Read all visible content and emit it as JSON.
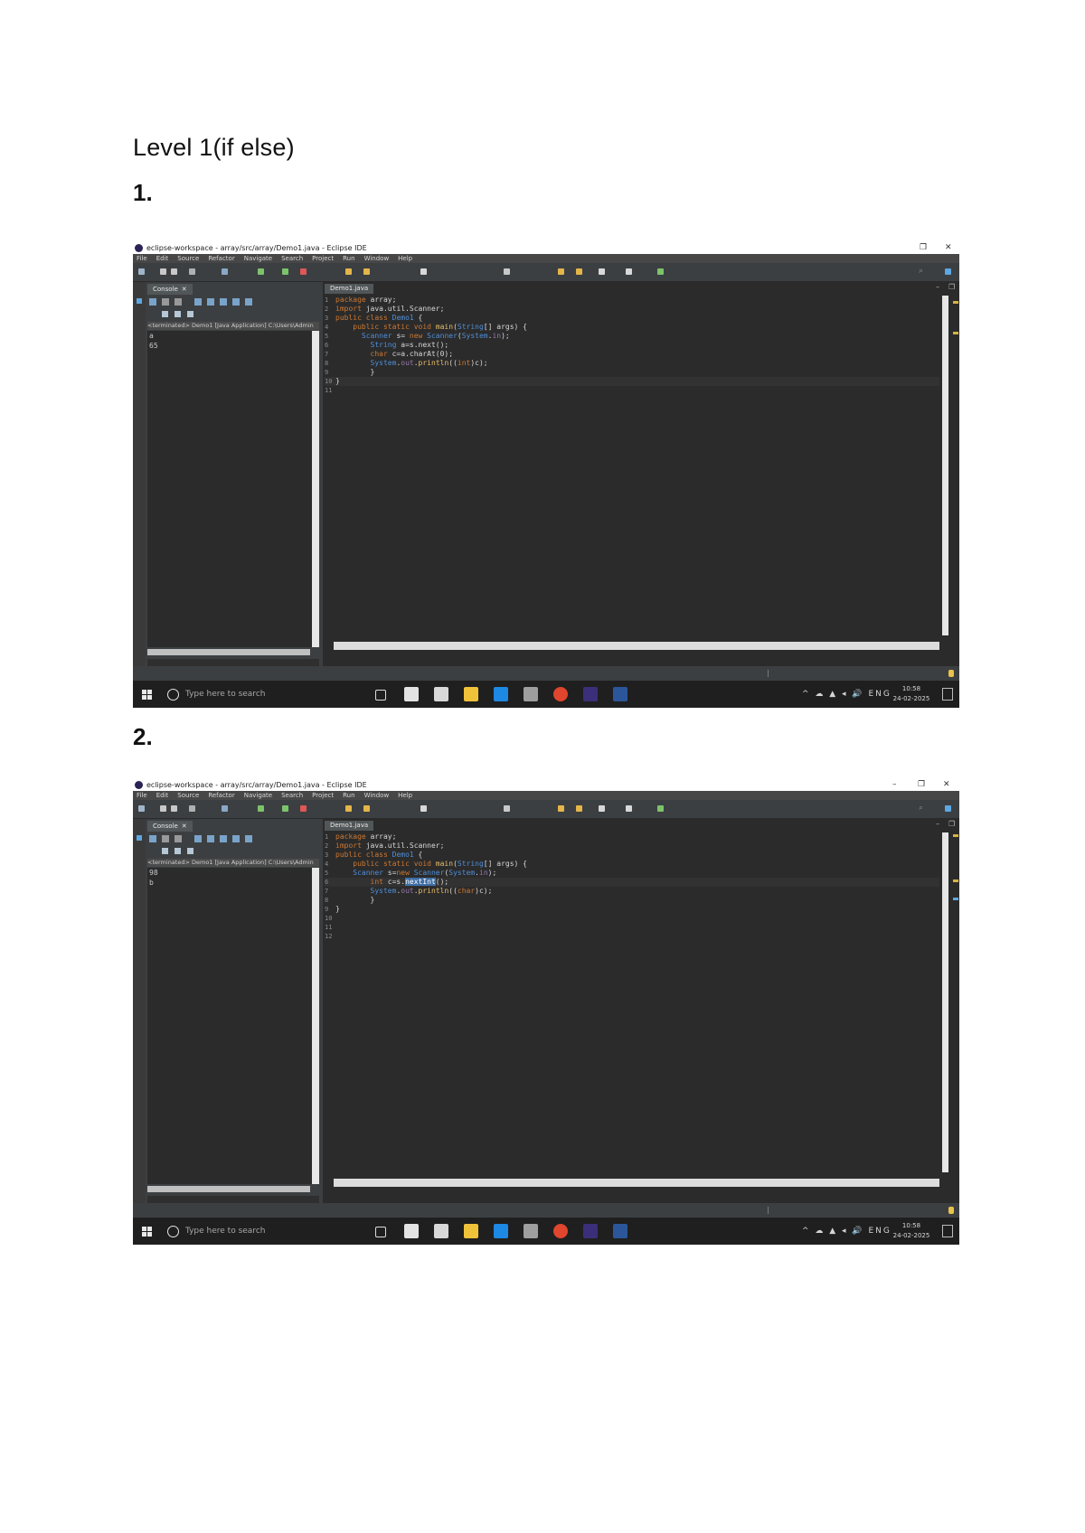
{
  "heading": "Level 1(if else)",
  "items": [
    {
      "number": "1.",
      "window_title": "eclipse-workspace - array/src/array/Demo1.java - Eclipse IDE",
      "menu": [
        "File",
        "Edit",
        "Source",
        "Refactor",
        "Navigate",
        "Search",
        "Project",
        "Run",
        "Window",
        "Help"
      ],
      "console_tab": "Console",
      "console_path": "<terminated> Demo1 [Java Application] C:\\Users\\Admin",
      "console_output": [
        "a",
        "65"
      ],
      "editor_tab": "Demo1.java",
      "taskbar_search": "Type here to search",
      "clock_time": "10:58",
      "clock_date": "24-02-2025"
    },
    {
      "number": "2.",
      "window_title": "eclipse-workspace - array/src/array/Demo1.java - Eclipse IDE",
      "menu": [
        "File",
        "Edit",
        "Source",
        "Refactor",
        "Navigate",
        "Search",
        "Project",
        "Run",
        "Window",
        "Help"
      ],
      "console_tab": "Console",
      "console_path": "<terminated> Demo1 [Java Application] C:\\Users\\Admin",
      "console_output": [
        "98",
        "b"
      ],
      "editor_tab": "Demo1.java",
      "taskbar_search": "Type here to search",
      "clock_time": "10:58",
      "clock_date": "24-02-2025"
    }
  ],
  "colors": {
    "ide_background": "#2b2b2b",
    "keyword": "#cc7832",
    "type": "#4f8ed8",
    "method": "#e8bf6a",
    "field": "#9876aa"
  }
}
